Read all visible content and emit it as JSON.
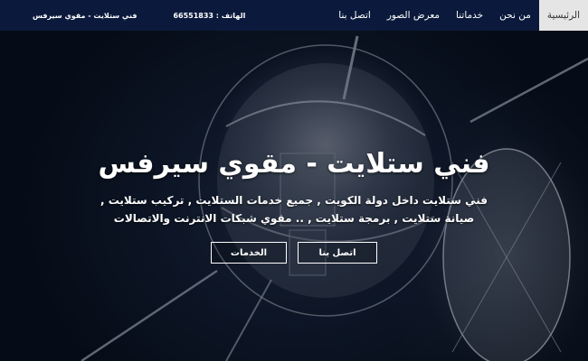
{
  "nav": {
    "items": [
      {
        "label": "الرئيسية",
        "active": true
      },
      {
        "label": "من نحن",
        "active": false
      },
      {
        "label": "خدماتنا",
        "active": false
      },
      {
        "label": "معرض الصور",
        "active": false
      },
      {
        "label": "اتصل بنا",
        "active": false
      }
    ],
    "phone": "الهاتف : 66551833",
    "brand": "فني ستلايت - مقوي سيرفس"
  },
  "hero": {
    "title": "فني ستلايت - مقوي سيرفس",
    "subtitle": "فني ستلايت داخل دولة الكويت , جميع خدمات الستلايت , تركيب ستلايت , صيانة ستلايت , برمجة ستلايت , .. مقوي شبكات الانترنت والاتصالات",
    "buttons": {
      "contact": "اتصل بنا",
      "services": "الخدمات"
    }
  },
  "colors": {
    "navbar": "#0b1a3c",
    "active_tab": "#e5e5e5",
    "hero_bg": "#101a2c"
  }
}
